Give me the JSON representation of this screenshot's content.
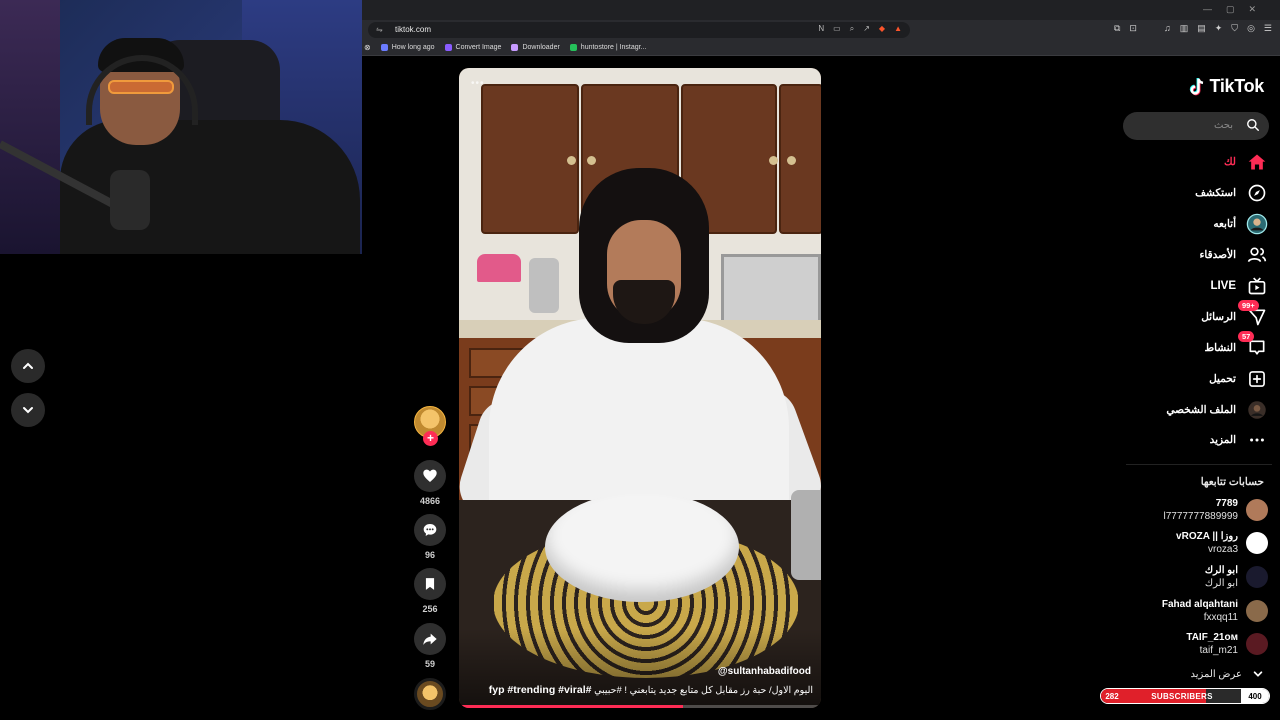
{
  "browser": {
    "url": "tiktok.com",
    "bookmarks": [
      {
        "label": "How long ago",
        "color": "#6b7cff"
      },
      {
        "label": "Convert Image",
        "color": "#8a5cff"
      },
      {
        "label": "Downloader",
        "color": "#c79bff"
      },
      {
        "label": "huntostore | Instagr...",
        "color": "#25c15a"
      }
    ]
  },
  "video": {
    "author": "@sultanhabadifood",
    "caption": "اليوم الاول/ حبة رز مقابل كل متابع جديد يتابعني ! #حبيبي",
    "hashtags": "#fyp #trending #viral",
    "progress": 0.62
  },
  "actions": {
    "likes": "4866",
    "comments": "96",
    "saves": "256",
    "shares": "59"
  },
  "sidebar": {
    "logo": "TikTok",
    "search_placeholder": "بحث",
    "nav": [
      {
        "label": "لك",
        "icon": "home-icon",
        "active": true
      },
      {
        "label": "استكشف",
        "icon": "compass-icon",
        "active": false
      },
      {
        "label": "أتابعه",
        "icon": "following-avatar-icon",
        "active": false
      },
      {
        "label": "الأصدقاء",
        "icon": "friends-icon",
        "active": false
      },
      {
        "label": "LIVE",
        "icon": "live-tv-icon",
        "active": false
      },
      {
        "label": "الرسائل",
        "icon": "messages-icon",
        "active": false,
        "badge": "99+"
      },
      {
        "label": "النشاط",
        "icon": "activity-icon",
        "active": false,
        "badge": "57"
      },
      {
        "label": "تحميل",
        "icon": "upload-icon",
        "active": false
      },
      {
        "label": "الملف الشخصي",
        "icon": "profile-avatar-icon",
        "active": false
      },
      {
        "label": "المزيد",
        "icon": "more-dots-icon",
        "active": false
      }
    ],
    "following_title": "حسابات تتابعها",
    "following": [
      {
        "name": "7789",
        "handle": "l7777777889999",
        "color": "#b07a5a"
      },
      {
        "name": "vROZA || روزا",
        "handle": "vroza3",
        "color": "#ffffff"
      },
      {
        "name": "ابو الرك",
        "handle": "ابو الرك",
        "color": "#1a1a2e"
      },
      {
        "name": "Fahad alqahtani",
        "handle": "fxxqq11",
        "color": "#8a6a4a"
      },
      {
        "name": "TAIF_21ᴏᴍ",
        "handle": "taif_m21",
        "color": "#5a1a22"
      }
    ],
    "see_more": "عرض المزيد"
  },
  "subscribers": {
    "current": "282",
    "label": "SUBSCRIBERS",
    "goal": "400",
    "fraction": 0.705
  },
  "colors": {
    "accent": "#fe2c55",
    "background": "#000000"
  }
}
